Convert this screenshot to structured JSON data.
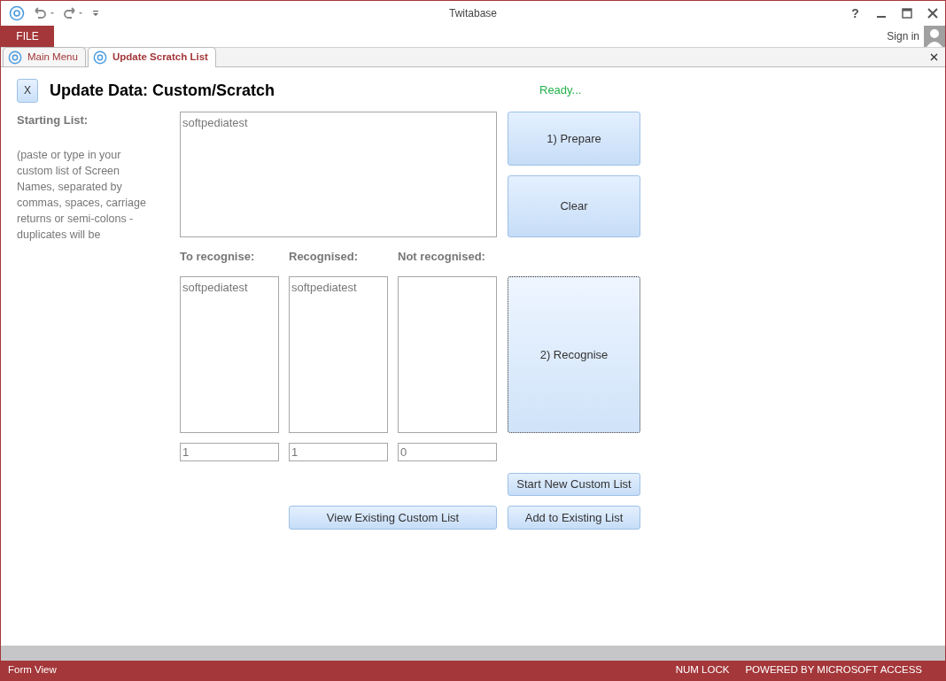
{
  "window": {
    "title": "Twitabase",
    "help": "?"
  },
  "ribbon": {
    "file_tab": "FILE",
    "sign_in": "Sign in"
  },
  "document_tabs": [
    {
      "label": "Main Menu",
      "selected": false
    },
    {
      "label": "Update Scratch List",
      "selected": true
    }
  ],
  "form": {
    "close_button": "X",
    "title": "Update Data: Custom/Scratch",
    "status": "Ready...",
    "starting_list_label": "Starting List:",
    "instructions": "(paste or type in your custom list of Screen Names, separated by commas, spaces, carriage returns or semi-colons - duplicates will be",
    "starting_list_value": "softpediatest",
    "lists": [
      {
        "label": "To recognise:",
        "value": "softpediatest",
        "count": "1"
      },
      {
        "label": "Recognised:",
        "value": "softpediatest",
        "count": "1"
      },
      {
        "label": "Not recognised:",
        "count": "0"
      }
    ],
    "prepare_button": {
      "label": "1) Prepare",
      "focused": false
    },
    "clear_button": {
      "label": "Clear",
      "focused": false
    },
    "recognise_button": {
      "label": "2) Recognise",
      "focused": true
    },
    "start_new_button": {
      "label": "Start New Custom List",
      "focused": false
    },
    "view_existing_button": {
      "label": "View Existing Custom List",
      "focused": false
    },
    "add_existing_button": {
      "label": "Add to Existing List",
      "focused": false
    }
  },
  "status_bar": {
    "view": "Form View",
    "num_lock": "NUM LOCK",
    "powered_by": "POWERED BY MICROSOFT ACCESS"
  }
}
